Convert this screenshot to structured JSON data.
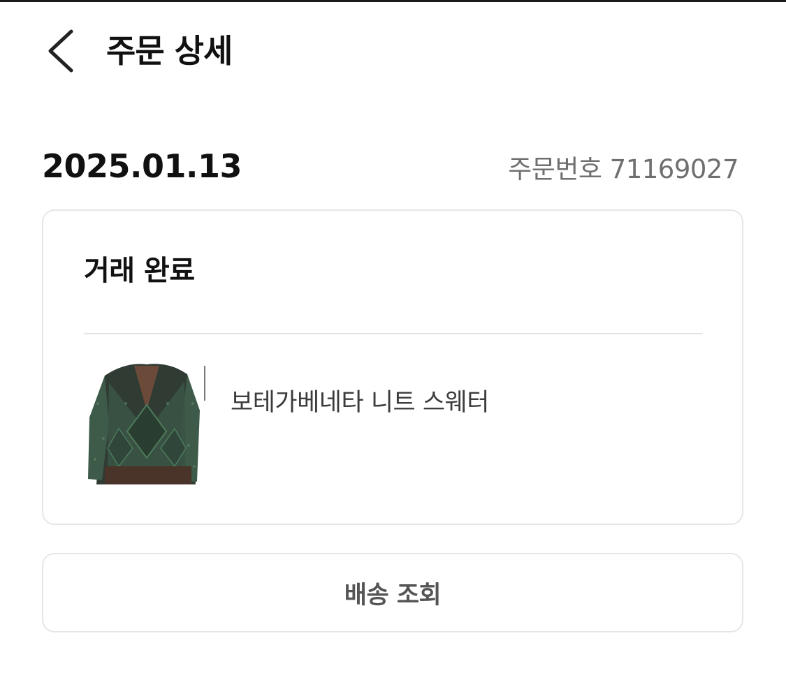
{
  "header": {
    "back_icon": "chevron-left-icon",
    "title": "주문 상세"
  },
  "order": {
    "date": "2025.01.13",
    "number_text": "주문번호 71169027",
    "status": "거래 완료",
    "product": {
      "name": "보테가베네타 니트 스웨터",
      "image": "green knit sweater photo"
    }
  },
  "actions": {
    "tracking_label": "배송 조회"
  },
  "colors": {
    "text_primary": "#111111",
    "text_secondary": "#6f6f6f",
    "border": "#e6e6e6"
  }
}
